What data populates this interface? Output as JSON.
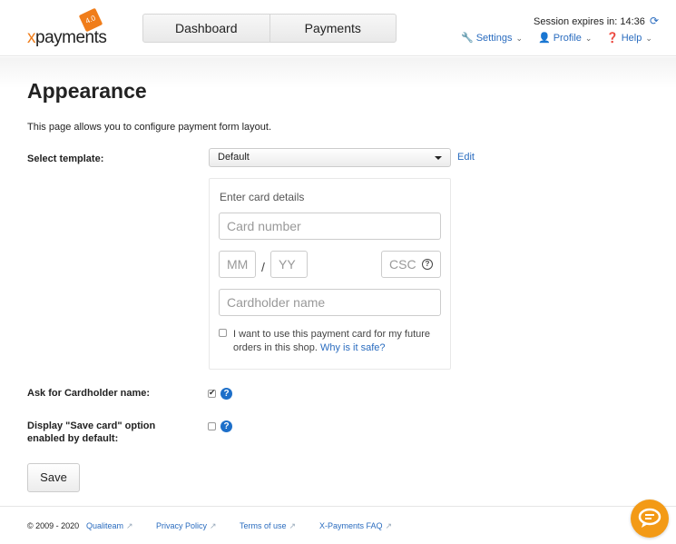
{
  "header": {
    "logo_text_x": "x",
    "logo_text_rest": "payments",
    "logo_badge": "4.0",
    "tabs": [
      {
        "label": "Dashboard"
      },
      {
        "label": "Payments"
      }
    ],
    "session_label": "Session expires in: 14:36",
    "menus": [
      {
        "label": "Settings",
        "icon": "wrench-icon"
      },
      {
        "label": "Profile",
        "icon": "user-icon"
      },
      {
        "label": "Help",
        "icon": "question-circle-icon"
      }
    ]
  },
  "page": {
    "title": "Appearance",
    "description": "This page allows you to configure payment form layout."
  },
  "template": {
    "label": "Select template:",
    "selected": "Default",
    "edit_label": "Edit"
  },
  "card_form": {
    "title": "Enter card details",
    "card_number_placeholder": "Card number",
    "mm_placeholder": "MM",
    "slash": "/",
    "yy_placeholder": "YY",
    "csc_placeholder": "CSC",
    "cardholder_placeholder": "Cardholder name",
    "save_card_text": "I want to use this payment card for my future orders in this shop.",
    "why_safe_link": "Why is it safe?"
  },
  "options": {
    "ask_cardholder_label": "Ask for Cardholder name:",
    "ask_cardholder_checked": true,
    "save_card_default_label": "Display \"Save card\" option enabled by default:",
    "save_card_default_checked": false
  },
  "actions": {
    "save_label": "Save"
  },
  "footer": {
    "copyright": "© 2009 - 2020",
    "links": [
      {
        "label": "Qualiteam"
      },
      {
        "label": "Privacy Policy"
      },
      {
        "label": "Terms of use"
      },
      {
        "label": "X-Payments FAQ"
      }
    ]
  },
  "colors": {
    "accent_orange": "#f07d1a",
    "link_blue": "#2a6cbf",
    "help_blue": "#1d6fc9",
    "chat_orange": "#f39a16"
  }
}
